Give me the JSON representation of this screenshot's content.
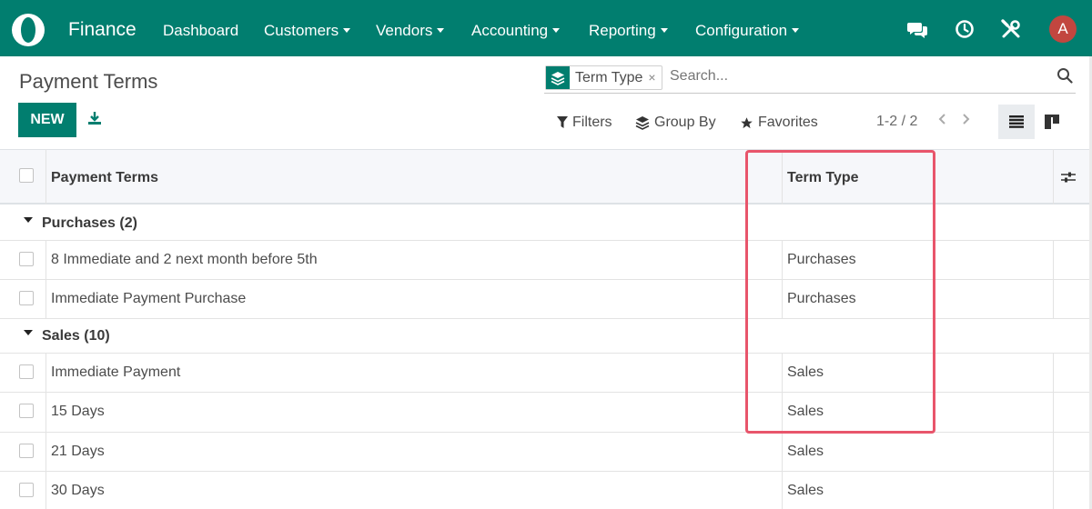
{
  "navbar": {
    "app_name": "Finance",
    "menus": [
      {
        "label": "Dashboard",
        "dropdown": false
      },
      {
        "label": "Customers",
        "dropdown": true
      },
      {
        "label": "Vendors",
        "dropdown": true
      },
      {
        "label": "Accounting",
        "dropdown": true
      },
      {
        "label": "Reporting",
        "dropdown": true
      },
      {
        "label": "Configuration",
        "dropdown": true
      }
    ],
    "avatar_initial": "A",
    "icons": [
      "chat-icon",
      "clock-icon",
      "tools-icon"
    ]
  },
  "control_panel": {
    "title": "Payment Terms",
    "new_label": "NEW",
    "search": {
      "facet_label": "Term Type",
      "facet_close": "×",
      "placeholder": "Search..."
    },
    "filters_label": "Filters",
    "group_by_label": "Group By",
    "favorites_label": "Favorites",
    "pager": "1-2 / 2"
  },
  "table": {
    "columns": [
      "Payment Terms",
      "Term Type"
    ],
    "groups": [
      {
        "label": "Purchases (2)",
        "rows": [
          {
            "name": "8 Immediate and 2 next month before 5th",
            "type": "Purchases"
          },
          {
            "name": "Immediate Payment Purchase",
            "type": "Purchases"
          }
        ]
      },
      {
        "label": "Sales (10)",
        "rows": [
          {
            "name": "Immediate Payment",
            "type": "Sales"
          },
          {
            "name": "15 Days",
            "type": "Sales"
          },
          {
            "name": "21 Days",
            "type": "Sales"
          },
          {
            "name": "30 Days",
            "type": "Sales"
          }
        ]
      }
    ]
  },
  "colors": {
    "brand": "#017e6f",
    "avatar": "#c2463f",
    "highlight": "#e8556b"
  }
}
